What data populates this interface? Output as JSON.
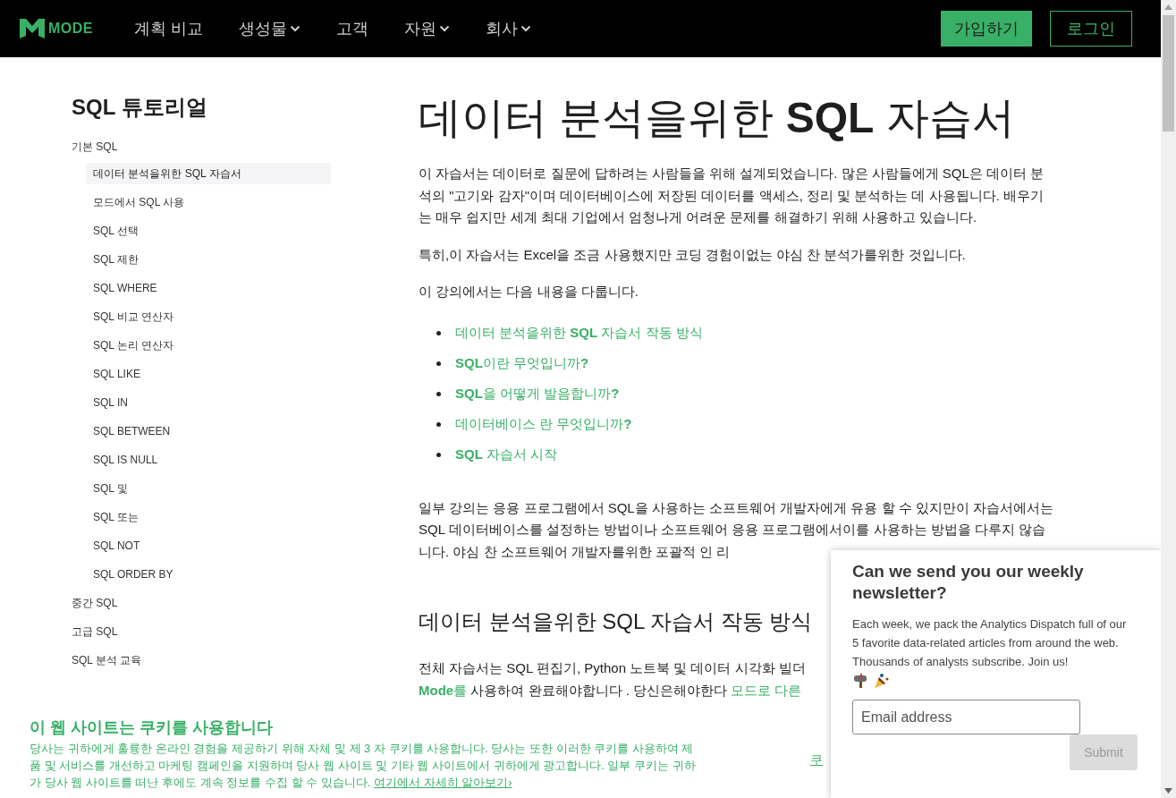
{
  "header": {
    "logo_text": "MODE",
    "nav": [
      {
        "label": "계획 비교",
        "dropdown": false
      },
      {
        "label": "생성물",
        "dropdown": true
      },
      {
        "label": "고객",
        "dropdown": false
      },
      {
        "label": "자원",
        "dropdown": true
      },
      {
        "label": "회사",
        "dropdown": true
      }
    ],
    "signup_button": "가입하기",
    "login_button": "로그인"
  },
  "sidebar": {
    "title": "SQL 튜토리얼",
    "items": [
      {
        "label": "기본 SQL",
        "selected": false,
        "children": [
          {
            "label": "데이터 분석을위한 SQL 자습서",
            "selected": true
          },
          {
            "label": "모드에서 SQL 사용",
            "selected": false
          },
          {
            "label": "SQL 선택",
            "selected": false
          },
          {
            "label": "SQL 제한",
            "selected": false
          },
          {
            "label": "SQL WHERE",
            "selected": false
          },
          {
            "label": "SQL 비교 연산자",
            "selected": false
          },
          {
            "label": "SQL 논리 연산자",
            "selected": false
          },
          {
            "label": "SQL LIKE",
            "selected": false
          },
          {
            "label": "SQL IN",
            "selected": false
          },
          {
            "label": "SQL BETWEEN",
            "selected": false
          },
          {
            "label": "SQL IS NULL",
            "selected": false
          },
          {
            "label": "SQL 및",
            "selected": false
          },
          {
            "label": "SQL 또는",
            "selected": false
          },
          {
            "label": "SQL NOT",
            "selected": false
          },
          {
            "label": "SQL ORDER BY",
            "selected": false
          }
        ]
      },
      {
        "label": "중간 SQL",
        "selected": false
      },
      {
        "label": "고급 SQL",
        "selected": false
      },
      {
        "label": "SQL 분석 교육",
        "selected": false
      }
    ]
  },
  "article": {
    "title": "데이터 분석을위한 **SQL** 자습서",
    "blocks": [
      {
        "kind": "paragraph",
        "text": "이 자습서는 데이터로 질문에 답하려는 사람들을 위해 설계되었습니다. 많은 사람들에게 SQL은 데이터 분석의 \"고기와 감자\"이며 데이터베이스에 저장된 데이터를 액세스, 정리 및 분석하는 데 사용됩니다. 배우기는 매우 쉽지만 세계 최대 기업에서 엄청나게 어려운 문제를 해결하기 위해 사용하고 있습니다."
      },
      {
        "kind": "paragraph",
        "text": "특히,이 자습서는 Excel을 조금 사용했지만 코딩 경험이없는 야심 찬 분석가를위한 것입니다."
      },
      {
        "kind": "paragraph",
        "text": "이 강의에서는 다음 내용을 다룹니다."
      },
      {
        "kind": "links",
        "items": [
          "데이터 분석을위한 **SQL** 자습서 작동 방식",
          "**SQL**이란 무엇입니까**?**",
          "**SQL**을 어떻게 발음합니까**?**",
          "데이터베이스 란 무엇입니까**?**",
          "**SQL** 자습서 시작"
        ]
      },
      {
        "kind": "paragraph",
        "text": "일부 강의는 응용 프로그램에서 SQL을 사용하는 소프트웨어 개발자에게 유용 할 수 있지만이 자습서에서는 SQL 데이터베이스를 설정하는 방법이나 소프트웨어 응용 프로그램에서이를 사용하는 방법을 다루지 않습니다. 야심 찬 소프트웨어 개발자를위한 포괄적 인 리"
      },
      {
        "kind": "heading",
        "text": "데이터 분석을위한 SQL 자습서 작동 방식"
      },
      {
        "kind": "mixed",
        "parts": [
          {
            "text": "전체 자습서는 SQL 편집기, Python 노트북 및 데이터 시각화 빌더",
            "link": false
          },
          {
            "text": "**Mode**를",
            "link": true
          },
          {
            "text": " 사용하여 완료해야합니다 . 당신은해야한다 ",
            "link": false
          },
          {
            "text": "모드로 다른",
            "link": true
          }
        ]
      }
    ]
  },
  "cookie_banner": {
    "title": "이 웹 사이트는 쿠키를 사용합니다",
    "text": "당사는 귀하에게 훌륭한 온라인 경험을 제공하기 위해 자체 및 제 3 자 쿠키를 사용합니다. 당사는 또한 이러한 쿠키를 사용하여 제품 및 서비스를 개선하고 마케팅 캠페인을 지원하며 당사 웹 사이트 및 기타 웹 사이트에서 귀하에게 광고합니다. 일부 쿠키는 귀하가 당사 웹 사이트를 떠난 후에도 계속 정보를 수집 할 수 있습니다.",
    "link": "여기에서 자세히 알아보기›",
    "settings_link": "쿠"
  },
  "newsletter": {
    "title": "Can we send you our weekly newsletter?",
    "text": "Each week, we pack the Analytics Dispatch full of our 5 favorite data-related articles from around the web. Thousands of analysts subscribe. Join us!",
    "email_placeholder": "Email address",
    "submit_button": "Submit"
  }
}
